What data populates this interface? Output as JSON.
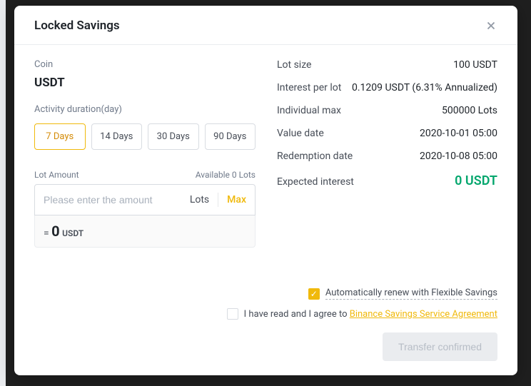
{
  "header": {
    "title": "Locked Savings"
  },
  "left": {
    "coin_label": "Coin",
    "coin": "USDT",
    "duration_label": "Activity duration(day)",
    "durations": [
      "7 Days",
      "14 Days",
      "30 Days",
      "90 Days"
    ],
    "lot_amount_label": "Lot Amount",
    "available": "Available 0 Lots",
    "input_placeholder": "Please enter the amount",
    "lots_text": "Lots",
    "max_text": "Max",
    "equals_prefix": "= ",
    "equals_value": "0",
    "equals_unit": "USDT"
  },
  "right": {
    "rows": [
      {
        "label": "Lot size",
        "value": "100 USDT"
      },
      {
        "label": "Interest per lot",
        "value": "0.1209 USDT (6.31% Annualized)"
      },
      {
        "label": "Individual max",
        "value": "500000 Lots"
      },
      {
        "label": "Value date",
        "value": "2020-10-01 05:00"
      },
      {
        "label": "Redemption date",
        "value": "2020-10-08 05:00"
      }
    ],
    "expected_label": "Expected interest",
    "expected_value": "0 USDT"
  },
  "footer": {
    "auto_renew": "Automatically renew with Flexible Savings",
    "agree_prefix": "I have read and I agree to ",
    "agree_link": "Binance Savings Service Agreement",
    "confirm": "Transfer confirmed"
  }
}
